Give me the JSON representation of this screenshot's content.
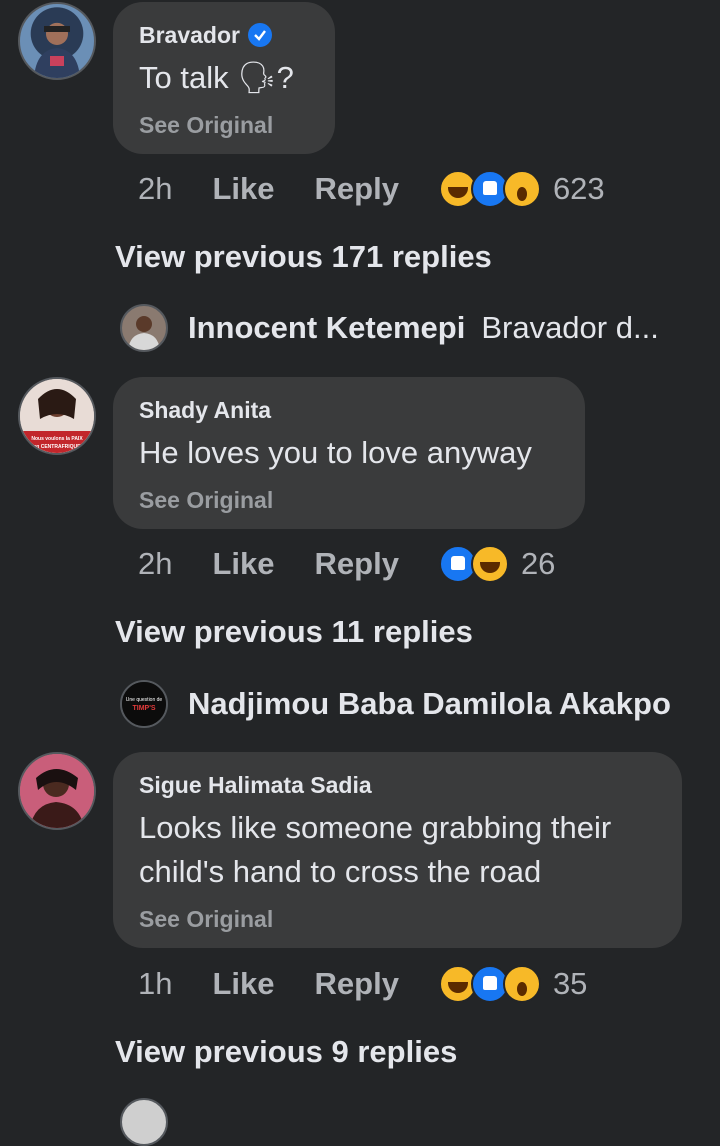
{
  "comments": [
    {
      "author": "Bravador",
      "verified": true,
      "text": "To talk 🗣?",
      "see_original": "See Original",
      "time": "2h",
      "like": "Like",
      "reply": "Reply",
      "reactions": [
        "haha",
        "like",
        "wow"
      ],
      "reaction_count": "623",
      "view_previous": "View previous 171 replies",
      "last_reply": {
        "name": "Innocent Ketemepi",
        "text": "Bravador d..."
      }
    },
    {
      "author": "Shady Anita",
      "avatar_caption": "Nous voulons la PAIX en CENTRAFRIQUE",
      "text": "He loves you to love anyway",
      "see_original": "See Original",
      "time": "2h",
      "like": "Like",
      "reply": "Reply",
      "reactions": [
        "like",
        "haha"
      ],
      "reaction_count": "26",
      "view_previous": "View previous 11 replies",
      "last_reply": {
        "name": "Nadjimou Baba Damilola Akakpo",
        "avatar_caption": "Une question de TIMP'S",
        "text": ""
      }
    },
    {
      "author": "Sigue Halimata Sadia",
      "text_line1": "Looks like someone grabbing their",
      "text_line2": "child's hand to cross the road",
      "see_original": "See Original",
      "time": "1h",
      "like": "Like",
      "reply": "Reply",
      "reactions": [
        "haha",
        "like",
        "wow"
      ],
      "reaction_count": "35",
      "view_previous": "View previous 9 replies"
    }
  ],
  "colors": {
    "background": "#232527",
    "bubble": "#3a3b3c",
    "primary_text": "#e4e6eb",
    "secondary_text": "#b0b3b8",
    "verified": "#1877f2"
  }
}
